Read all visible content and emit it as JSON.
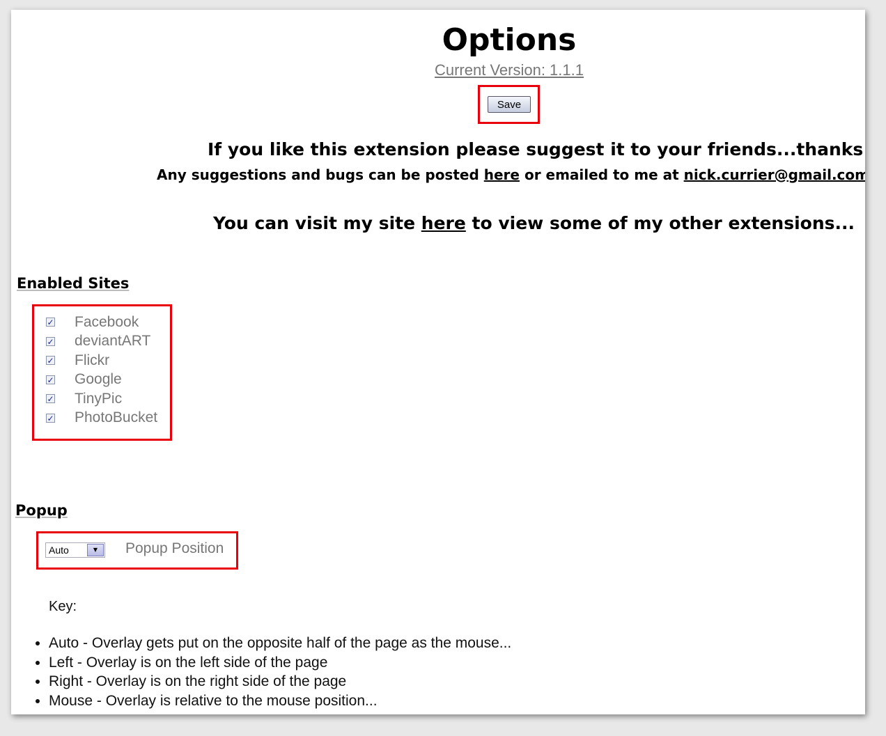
{
  "header": {
    "title": "Options",
    "version": "Current Version: 1.1.1",
    "save_label": "Save"
  },
  "messages": {
    "line1": "If you like this extension please suggest it to your friends...thanks",
    "line2_prefix": "Any suggestions and bugs can be posted ",
    "line2_link": "here",
    "line2_middle": " or emailed to me at ",
    "line2_email": "nick.currier@gmail.com",
    "line3_prefix": "You can visit my site ",
    "line3_link": "here",
    "line3_suffix": " to view some of my other extensions..."
  },
  "enabled_sites": {
    "heading": "Enabled Sites",
    "items": [
      {
        "label": "Facebook",
        "checked": true
      },
      {
        "label": "deviantART",
        "checked": true
      },
      {
        "label": "Flickr",
        "checked": true
      },
      {
        "label": "Google",
        "checked": true
      },
      {
        "label": "TinyPic",
        "checked": true
      },
      {
        "label": "PhotoBucket",
        "checked": true
      }
    ]
  },
  "popup": {
    "heading": "Popup",
    "select_value": "Auto",
    "position_label": "Popup Position",
    "key_label": "Key:",
    "key_items": [
      "Auto - Overlay gets put on the opposite half of the page as the mouse...",
      "Left - Overlay is on the left side of the page",
      "Right - Overlay is on the right side of the page",
      "Mouse - Overlay is relative to the mouse position..."
    ]
  },
  "colors": {
    "highlight_box": "#e8000b",
    "label_gray": "#777777"
  }
}
